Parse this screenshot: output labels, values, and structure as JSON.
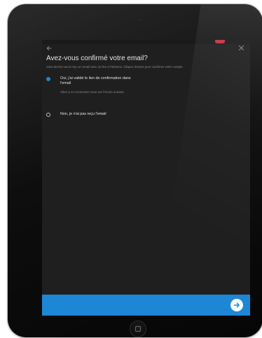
{
  "header": {
    "back_icon": "arrow-left-icon",
    "close_icon": "close-icon",
    "title": "Avez-vous confirmé votre email?",
    "subtitle": "Vous devriez avoir reçu un email avec un lien à l'intérieur. Cliquez dessus pour confirmer votre compte."
  },
  "options": [
    {
      "label": "Oui, j'ai validé le lien de confirmation dans l'email",
      "description": "Allez-y et connectez-vous sur l'écran suivant.",
      "selected": true
    },
    {
      "label": "Non, je n'ai pas reçu l'email",
      "description": "",
      "selected": false
    }
  ],
  "footer": {
    "next_icon": "arrow-right-icon"
  },
  "colors": {
    "accent": "#1d87d5",
    "background": "#201f1f",
    "badge": "#c0343f"
  }
}
